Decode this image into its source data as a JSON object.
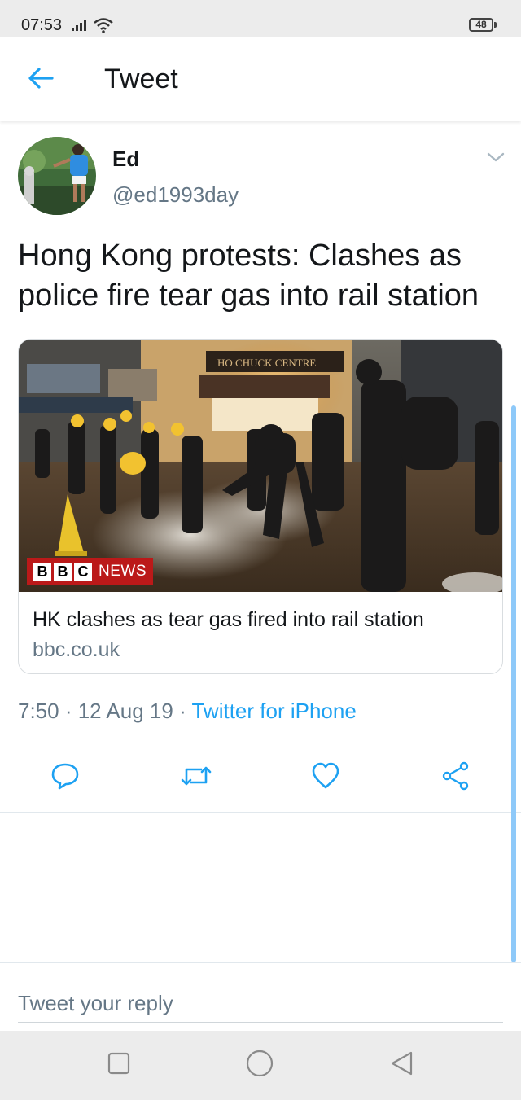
{
  "status_bar": {
    "time": "07:53",
    "battery": "48"
  },
  "header": {
    "title": "Tweet",
    "back_icon": "arrow-left-icon"
  },
  "tweet": {
    "author": {
      "display_name": "Ed",
      "handle": "@ed1993day"
    },
    "text": "Hong Kong protests: Clashes as police fire tear gas into rail station",
    "card": {
      "title": "HK clashes as tear gas fired into rail station",
      "domain": "bbc.co.uk",
      "image_badge": {
        "letters": [
          "B",
          "B",
          "C"
        ],
        "label": "NEWS"
      },
      "image_sign": "HO CHUCK CENTRE"
    },
    "meta": {
      "time": "7:50",
      "separator": " · ",
      "date": "12 Aug 19",
      "source": "Twitter for iPhone"
    }
  },
  "actions": {
    "reply_icon": "reply-icon",
    "retweet_icon": "retweet-icon",
    "like_icon": "heart-icon",
    "share_icon": "share-icon"
  },
  "reply_bar": {
    "placeholder": "Tweet your reply"
  },
  "colors": {
    "accent": "#1da1f2",
    "secondary_text": "#657786",
    "primary_text": "#14171a",
    "bbc_red": "#bb1919"
  }
}
